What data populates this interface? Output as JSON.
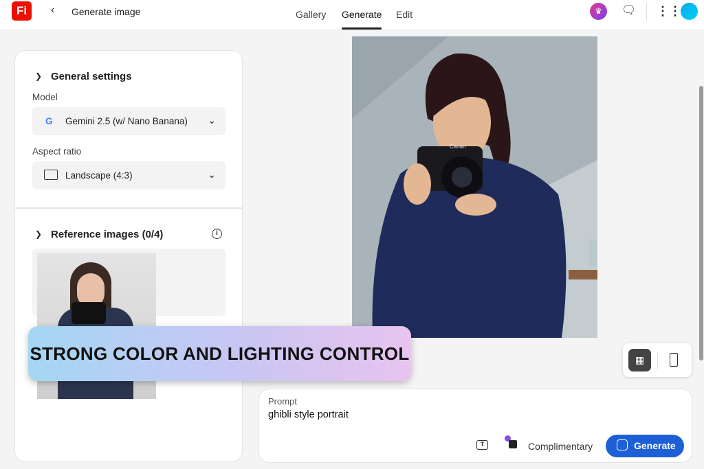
{
  "header": {
    "logo": "Fi",
    "title": "Generate image",
    "tabs": [
      "Gallery",
      "Generate",
      "Edit"
    ],
    "active_tab": "Generate"
  },
  "settings": {
    "general_title": "General settings",
    "model_label": "Model",
    "model_value": "Gemini 2.5 (w/ Nano Banana)",
    "aspect_label": "Aspect ratio",
    "aspect_value": "Landscape (4:3)",
    "reference_title": "Reference images (0/4)"
  },
  "prompt": {
    "label": "Prompt",
    "value": "ghibli style portrait",
    "credits_label": "Complimentary",
    "generate_label": "Generate"
  },
  "banner": {
    "text": "STRONG COLOR AND LIGHTING CONTROL"
  },
  "image": {
    "camera_brand": "Canan"
  },
  "colors": {
    "accent": "#1d5fd6",
    "brand": "#eb1000"
  }
}
